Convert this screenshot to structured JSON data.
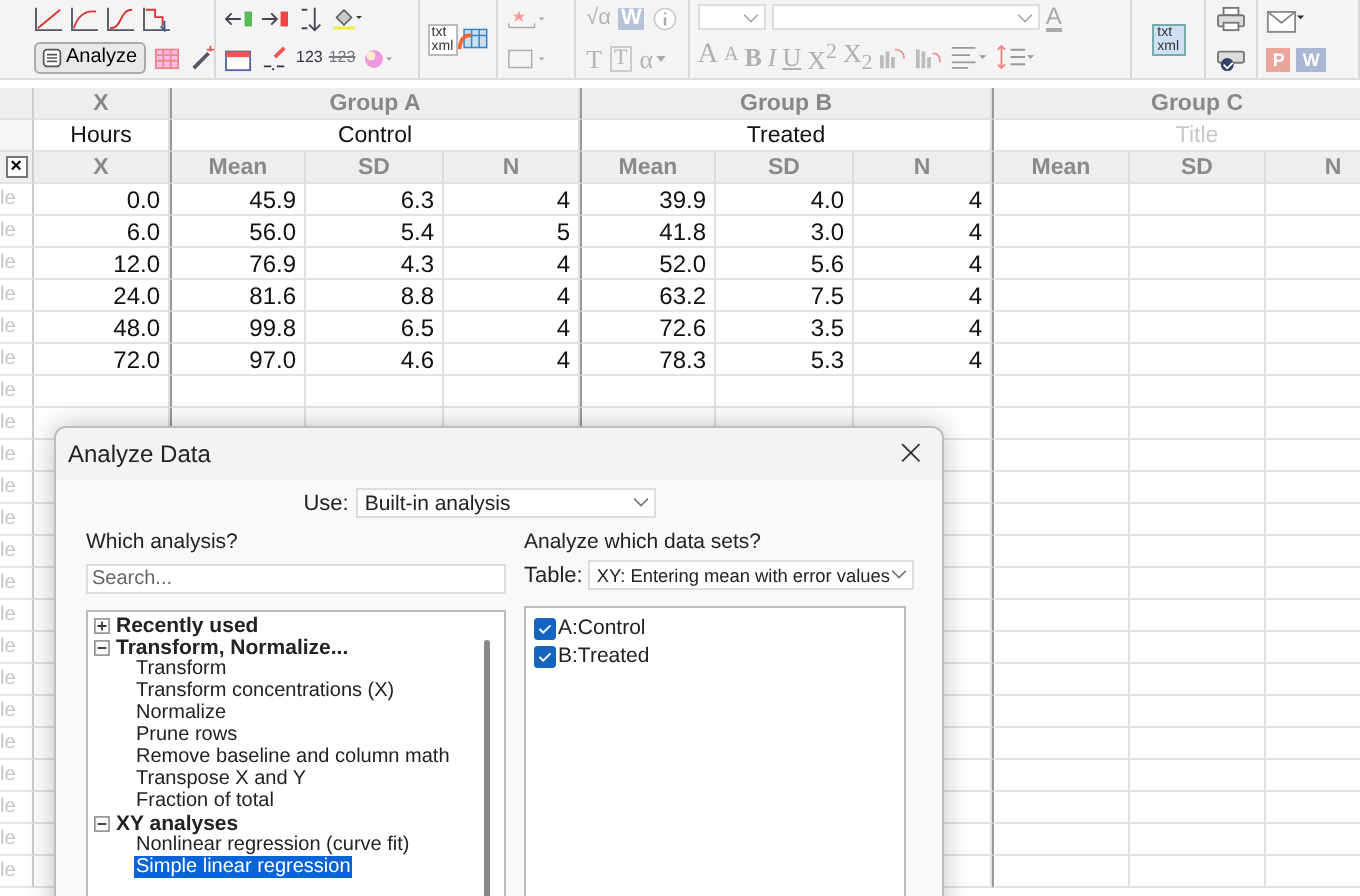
{
  "toolbar": {
    "analyze_button": "Analyze",
    "number_buttons": [
      {
        "text": "123",
        "struck": false
      },
      {
        "text": "123",
        "struck": true
      }
    ],
    "export_icons": [
      {
        "labels": [
          "txt",
          "xml"
        ]
      },
      {
        "labels": [
          "txt",
          "xml"
        ]
      }
    ],
    "symbol_row_1": [
      {
        "text": "√α",
        "kind": "plain"
      },
      {
        "text": "W",
        "kind": "tile"
      }
    ],
    "symbol_row_2": [
      {
        "text": "T",
        "kind": "plain"
      },
      {
        "text": "T",
        "kind": "boxed"
      },
      {
        "text": "α",
        "kind": "caret"
      }
    ],
    "format_buttons": [
      {
        "text": "A",
        "kind": "large"
      },
      {
        "text": "A",
        "kind": "small"
      },
      {
        "text": "B",
        "kind": "bold"
      },
      {
        "text": "I",
        "kind": "italic"
      },
      {
        "text": "U",
        "kind": "underline"
      },
      {
        "text": "X$^{2}$",
        "kind": "plain"
      },
      {
        "text": "X$_{2}$",
        "kind": "plain"
      }
    ],
    "font_color_label": "A",
    "share_tiles": [
      {
        "text": "P",
        "color": "#e8a79a"
      },
      {
        "text": "W",
        "color": "#a9b7d3"
      }
    ]
  },
  "table": {
    "corner": "×",
    "groups": [
      {
        "label": "X",
        "title": "Hours",
        "columns": [
          "X"
        ]
      },
      {
        "label": "Group A",
        "title": "Control",
        "columns": [
          "Mean",
          "SD",
          "N"
        ]
      },
      {
        "label": "Group B",
        "title": "Treated",
        "columns": [
          "Mean",
          "SD",
          "N"
        ]
      },
      {
        "label": "Group C",
        "placeholder": "Title",
        "columns": [
          "Mean",
          "SD",
          "N"
        ]
      }
    ],
    "rows": [
      {
        "label": "le",
        "cells": [
          "0.0",
          "45.9",
          "6.3",
          "4",
          "39.9",
          "4.0",
          "4"
        ]
      },
      {
        "label": "le",
        "cells": [
          "6.0",
          "56.0",
          "5.4",
          "5",
          "41.8",
          "3.0",
          "4"
        ]
      },
      {
        "label": "le",
        "cells": [
          "12.0",
          "76.9",
          "4.3",
          "4",
          "52.0",
          "5.6",
          "4"
        ]
      },
      {
        "label": "le",
        "cells": [
          "24.0",
          "81.6",
          "8.8",
          "4",
          "63.2",
          "7.5",
          "4"
        ]
      },
      {
        "label": "le",
        "cells": [
          "48.0",
          "99.8",
          "6.5",
          "4",
          "72.6",
          "3.5",
          "4"
        ]
      },
      {
        "label": "le",
        "cells": [
          "72.0",
          "97.0",
          "4.6",
          "4",
          "78.3",
          "5.3",
          "4"
        ]
      },
      {
        "label": "le",
        "cells": []
      },
      {
        "label": "le",
        "cells": []
      },
      {
        "label": "le",
        "cells": []
      },
      {
        "label": "le",
        "cells": []
      },
      {
        "label": "le",
        "cells": []
      },
      {
        "label": "le",
        "cells": []
      },
      {
        "label": "le",
        "cells": []
      },
      {
        "label": "le",
        "cells": []
      },
      {
        "label": "le",
        "cells": []
      },
      {
        "label": "le",
        "cells": []
      },
      {
        "label": "le",
        "cells": []
      },
      {
        "label": "le",
        "cells": []
      },
      {
        "label": "le",
        "cells": []
      },
      {
        "label": "le",
        "cells": []
      },
      {
        "label": "le",
        "cells": []
      },
      {
        "label": "le",
        "cells": []
      }
    ]
  },
  "dialog": {
    "title": "Analyze Data",
    "close": "×",
    "use_label": "Use:",
    "use_value": "Built-in analysis",
    "which_label": "Which analysis?",
    "search_placeholder": "Search...",
    "tree": [
      {
        "label": "Recently used",
        "expanded": false
      },
      {
        "label": "Transform, Normalize...",
        "expanded": true,
        "children": [
          {
            "label": "Transform",
            "selected": false
          },
          {
            "label": "Transform concentrations (X)",
            "selected": false
          },
          {
            "label": "Normalize",
            "selected": false
          },
          {
            "label": "Prune rows",
            "selected": false
          },
          {
            "label": "Remove baseline and column math",
            "selected": false
          },
          {
            "label": "Transpose X and Y",
            "selected": false
          },
          {
            "label": "Fraction of total",
            "selected": false
          }
        ]
      },
      {
        "label": "XY analyses",
        "expanded": true,
        "children": [
          {
            "label": "Nonlinear regression (curve fit)",
            "selected": false
          },
          {
            "label": "Simple linear regression",
            "selected": true
          }
        ]
      }
    ],
    "datasets_label": "Analyze which data sets?",
    "table_label": "Table:",
    "table_value": "XY: Entering mean with error values",
    "datasets": [
      {
        "label": "A:Control",
        "checked": true
      },
      {
        "label": "B:Treated",
        "checked": true
      }
    ]
  }
}
